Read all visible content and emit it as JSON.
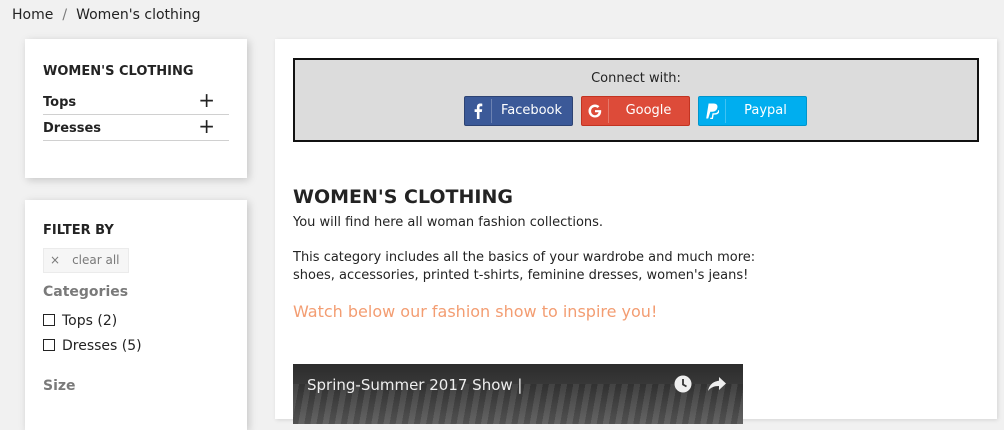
{
  "breadcrumb": {
    "home": "Home",
    "separator": "/",
    "current": "Women's clothing"
  },
  "category_block": {
    "title": "WOMEN'S CLOTHING",
    "items": [
      {
        "label": "Tops",
        "toggle": "+"
      },
      {
        "label": "Dresses",
        "toggle": "+"
      }
    ]
  },
  "filters": {
    "title": "FILTER BY",
    "clear_all": "clear all",
    "clear_icon": "×",
    "categories_title": "Categories",
    "categories": [
      {
        "label": "Tops (2)"
      },
      {
        "label": "Dresses (5)"
      }
    ],
    "size_title": "Size"
  },
  "connect": {
    "caption": "Connect with:",
    "buttons": [
      {
        "label": "Facebook",
        "icon": "facebook-icon",
        "color": "#3b5998"
      },
      {
        "label": "Google",
        "icon": "google-icon",
        "color": "#dd4b39"
      },
      {
        "label": "Paypal",
        "icon": "paypal-icon",
        "color": "#00aeef"
      }
    ]
  },
  "main": {
    "heading": "WOMEN'S CLOTHING",
    "intro": "You will find here all woman fashion collections.",
    "desc_line1": "This category includes all the basics of your wardrobe and much more:",
    "desc_line2": "shoes, accessories, printed t-shirts, feminine dresses, women's jeans!",
    "promo": "Watch below our fashion show to inspire you!",
    "promo_color": "#f39d72"
  },
  "video": {
    "title": "Spring-Summer 2017 Show |",
    "icons": [
      "clock-icon",
      "share-icon"
    ]
  }
}
